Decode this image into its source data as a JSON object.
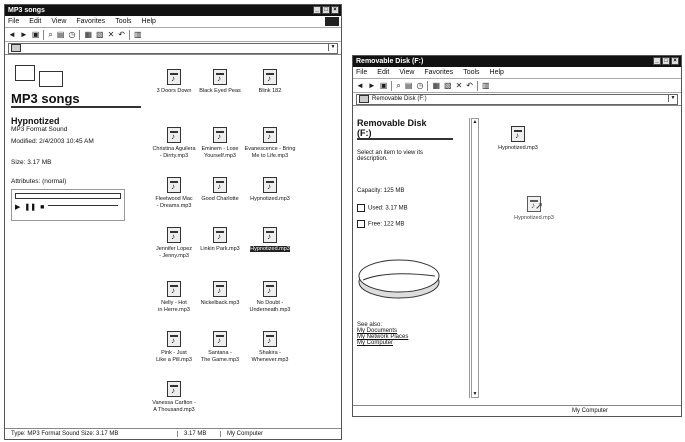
{
  "explorer": {
    "title": "MP3 songs",
    "menu": [
      "File",
      "Edit",
      "View",
      "Favorites",
      "Tools",
      "Help"
    ],
    "address": "",
    "folder_heading": "MP3 songs",
    "selection_title": "Hypnotized",
    "selection_type": "MP3 Format Sound",
    "selection_modified": "Modified: 2/4/2003 10:45 AM",
    "selection_size": "Size: 3.17 MB",
    "attributes": "Attributes: (normal)",
    "files": [
      {
        "name": "3 Doors Down"
      },
      {
        "name": "Black Eyed Peas"
      },
      {
        "name": "Blink 182"
      },
      {
        "name": "Christina Aguilera\n- Dirrty.mp3"
      },
      {
        "name": "Eminem - Lose\nYourself.mp3"
      },
      {
        "name": "Evanescence - Bring\nMe to Life.mp3"
      },
      {
        "name": "Fleetwood Mac\n- Dreams.mp3"
      },
      {
        "name": "Good Charlotte"
      },
      {
        "name": "Hypnotized.mp3"
      },
      {
        "name": "Jennifer Lopez\n- Jenny.mp3"
      },
      {
        "name": "Linkin Park.mp3"
      },
      {
        "name": "Hypnotized.mp3",
        "selected": true
      },
      {
        "name": "Nelly - Hot\nin Herre.mp3"
      },
      {
        "name": "Nickelback.mp3"
      },
      {
        "name": "No Doubt -\nUnderneath.mp3"
      },
      {
        "name": "Pink - Just\nLike a Pill.mp3"
      },
      {
        "name": "Santana -\nThe Game.mp3"
      },
      {
        "name": "Shakira -\nWhenever.mp3"
      },
      {
        "name": "Vanessa Carlton -\nA Thousand.mp3"
      }
    ],
    "status_left": "Type: MP3 Format Sound Size: 3.17 MB",
    "status_mid": "3.17 MB",
    "status_right": "My Computer"
  },
  "removable": {
    "title": "Removable Disk (F:)",
    "menu": [
      "File",
      "Edit",
      "View",
      "Favorites",
      "Tools",
      "Help"
    ],
    "address": "Removable Disk (F:)",
    "heading_line1": "Removable Disk",
    "heading_line2": "(F:)",
    "hint": "Select an item to view its description.",
    "capacity_label": "Capacity: 125 MB",
    "used_label": "Used: 3.17 MB",
    "free_label": "Free: 122 MB",
    "links_label": "See also:",
    "links": [
      "My Documents",
      "My Network Places",
      "My Computer"
    ],
    "file_item": "Hypnotized.mp3",
    "drag_item": "Hypnotized.mp3",
    "status_right": "My Computer"
  }
}
